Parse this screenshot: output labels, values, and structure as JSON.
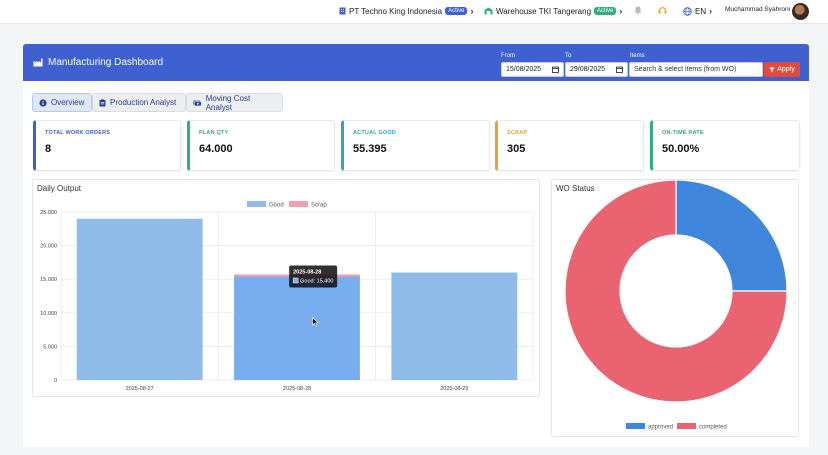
{
  "topbar": {
    "company": "PT Techno King Indonesia",
    "company_badge": "Active",
    "warehouse": "Warehouse TKI Tangerang",
    "warehouse_badge": "Active",
    "language": "EN",
    "user": "Muchammad Syahroni"
  },
  "header": {
    "title": "Manufacturing Dashboard",
    "from_label": "From",
    "from_value": "15/08/2025",
    "to_label": "To",
    "to_value": "29/08/2025",
    "items_label": "Items",
    "items_placeholder": "Search & select items (from WO)",
    "apply_label": "Apply"
  },
  "tabs": [
    {
      "label": "Overview",
      "active": true
    },
    {
      "label": "Production Analyst",
      "active": false
    },
    {
      "label": "Moving Cost Analyst",
      "active": false
    }
  ],
  "kpis": [
    {
      "label": "TOTAL WORK ORDERS",
      "value": "8",
      "color": "#3f60d1"
    },
    {
      "label": "PLAN QTY",
      "value": "64.000",
      "color": "#2fae7a"
    },
    {
      "label": "ACTUAL GOOD",
      "value": "55.395",
      "color": "#2aa7c4"
    },
    {
      "label": "SCRAP",
      "value": "305",
      "color": "#e8a33a"
    },
    {
      "label": "ON-TIME RATE",
      "value": "50.00%",
      "color": "#2fae7a"
    }
  ],
  "daily_output": {
    "title": "Daily Output",
    "tooltip": {
      "date": "2025-08-28",
      "text": "Good: 15.400"
    }
  },
  "wo_status": {
    "title": "WO Status"
  },
  "chart_data": [
    {
      "type": "bar",
      "title": "Daily Output",
      "categories": [
        "2025-08-27",
        "2025-08-28",
        "2025-08-29"
      ],
      "series": [
        {
          "name": "Good",
          "values": [
            24000,
            15400,
            15995
          ],
          "color": "#8fbbe8"
        },
        {
          "name": "Scrap",
          "values": [
            0,
            305,
            0
          ],
          "color": "#f2a0ac"
        }
      ],
      "stacked": true,
      "ylim": [
        0,
        25000
      ],
      "yticks": [
        "0",
        "5.000",
        "10.000",
        "15.000",
        "20.000",
        "25.000"
      ],
      "legend": "top",
      "grid": true
    },
    {
      "type": "pie",
      "donut": true,
      "title": "WO Status",
      "categories": [
        "approved",
        "completed"
      ],
      "values": [
        2,
        6
      ],
      "colors": [
        "#3f86dc",
        "#ea6370"
      ],
      "legend": "bottom"
    }
  ]
}
